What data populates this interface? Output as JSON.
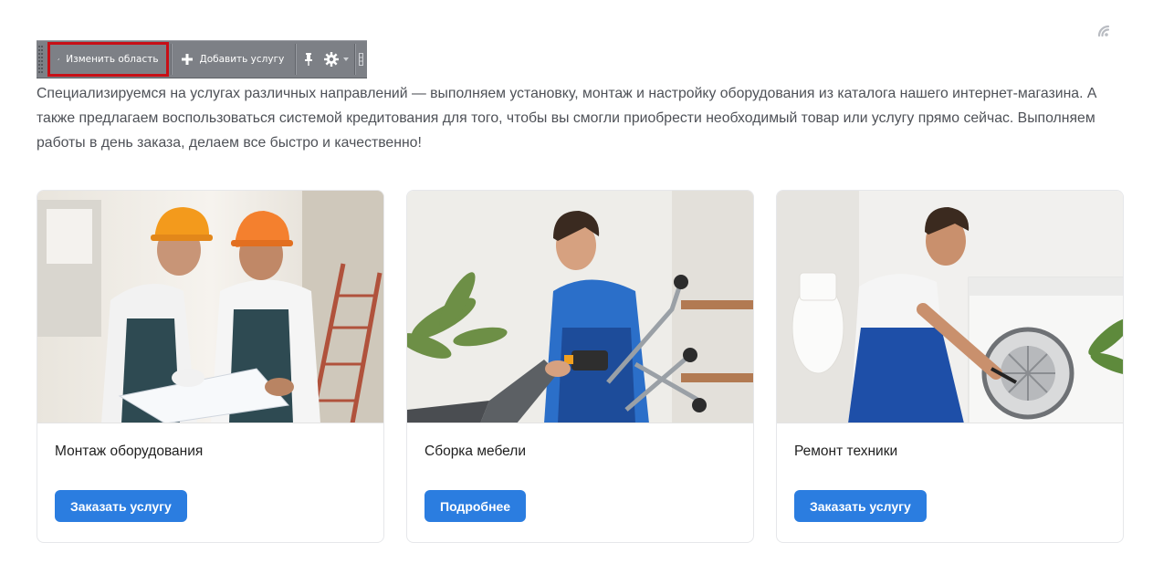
{
  "toolbar": {
    "edit_label": "Изменить область",
    "add_label": "Добавить услугу",
    "icons": [
      "pencil-icon",
      "plus-icon",
      "pin-icon",
      "gear-icon",
      "chevron-down-icon"
    ]
  },
  "intro": {
    "text": "Специализируемся на услугах различных направлений — выполняем установку, монтаж и настройку оборудования из каталога нашего интернет-магазина. А также предлагаем воспользоваться системой кредитования для того, чтобы вы смогли приобрести необходимый товар или услугу прямо сейчас. Выполняем работы в день заказа, делаем все быстро и качественно!"
  },
  "cards": [
    {
      "title": "Монтаж оборудования",
      "button": "Заказать услугу"
    },
    {
      "title": "Сборка мебели",
      "button": "Подробнее"
    },
    {
      "title": "Ремонт техники",
      "button": "Заказать услугу"
    }
  ],
  "colors": {
    "accent": "#2b7de0",
    "toolbar_bg": "#7d8086",
    "highlight": "#c80f16",
    "text": "#4e5157"
  }
}
